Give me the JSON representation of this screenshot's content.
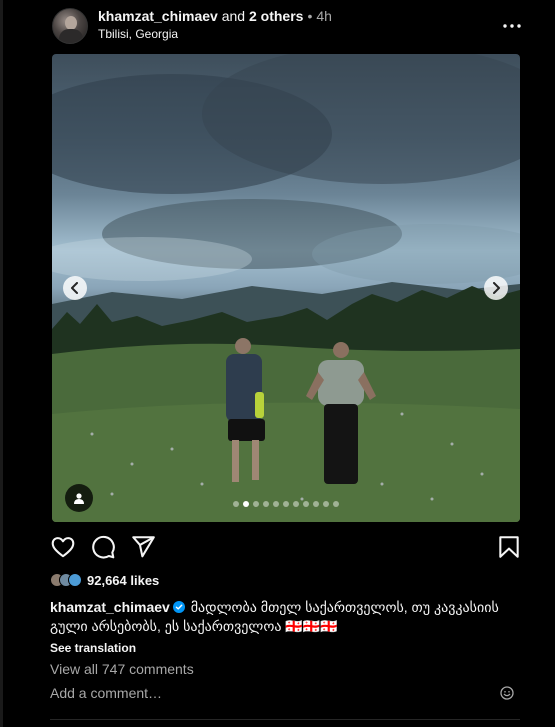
{
  "post": {
    "author": "khamzat_chimaev",
    "coauthors_text": "and",
    "others_text": "2 others",
    "separator": "•",
    "time": "4h",
    "location": "Tbilisi, Georgia",
    "more_icon": "more-horizontal-icon"
  },
  "media": {
    "slide_count": 11,
    "active_slide": 1,
    "prev_icon": "chevron-left-icon",
    "next_icon": "chevron-right-icon",
    "tag_icon": "user-tag-icon"
  },
  "actions": {
    "like_icon": "heart-icon",
    "comment_icon": "comment-icon",
    "share_icon": "send-icon",
    "save_icon": "bookmark-icon"
  },
  "likes": {
    "count_text": "92,664 likes"
  },
  "caption": {
    "username": "khamzat_chimaev",
    "verified_icon": "verified-badge-icon",
    "text": "მადლობა მთელ საქართველოს, თუ კავკასიის გული არსებობს, ეს საქართველოა 🇬🇪🇬🇪🇬🇪"
  },
  "see_translation": "See translation",
  "view_comments": "View all 747 comments",
  "comment_input": {
    "placeholder": "Add a comment…",
    "emoji_icon": "emoji-icon"
  },
  "colors": {
    "background": "#000000",
    "text": "#f5f5f5",
    "muted": "#a8a8a8",
    "verified": "#0095f6"
  }
}
